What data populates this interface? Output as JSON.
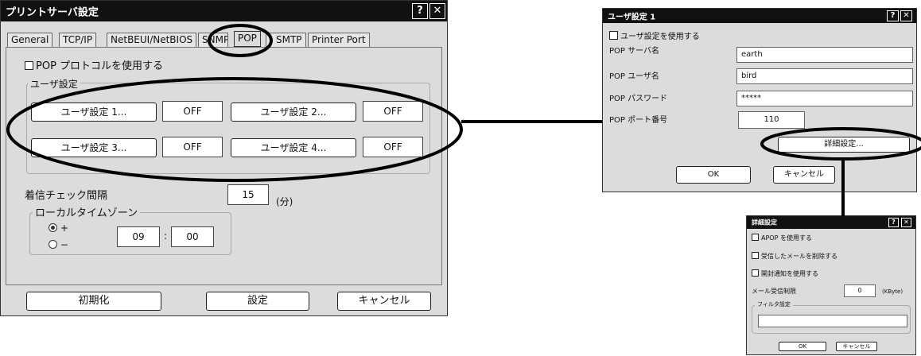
{
  "main_dialog": {
    "title": "プリントサーバ設定",
    "help": "?",
    "close": "✕",
    "tabs": [
      "General",
      "TCP/IP",
      "NetBEUI/NetBIOS",
      "SNMP",
      "POP",
      "SMTP",
      "Printer Port"
    ],
    "use_pop": "POP プロトコルを使用する",
    "user_group_title": "ユーザ設定",
    "users": [
      {
        "button": "ユーザ設定 1...",
        "status": "OFF"
      },
      {
        "button": "ユーザ設定 2...",
        "status": "OFF"
      },
      {
        "button": "ユーザ設定 3...",
        "status": "OFF"
      },
      {
        "button": "ユーザ設定 4...",
        "status": "OFF"
      }
    ],
    "check_interval_label": "着信チェック間隔",
    "check_interval_value": "15",
    "check_interval_unit": "(分)",
    "tz_group_title": "ローカルタイムゾーン",
    "tz_plus": "+",
    "tz_minus": "−",
    "tz_hours": "09",
    "tz_sep": ":",
    "tz_minutes": "00",
    "init_button": "初期化",
    "set_button": "設定",
    "cancel_button": "キャンセル"
  },
  "user_dialog": {
    "title": "ユーザ設定 1",
    "help": "?",
    "close": "✕",
    "use_user": "ユーザ設定を使用する",
    "fields": [
      {
        "label": "POP サーバ名",
        "value": "earth"
      },
      {
        "label": "POP ユーザ名",
        "value": "bird"
      },
      {
        "label": "POP パスワード",
        "value": "*****"
      }
    ],
    "port_label": "POP ポート番号",
    "port_value": "110",
    "detail_button": "詳細設定...",
    "ok_button": "OK",
    "cancel_button": "キャンセル"
  },
  "detail_dialog": {
    "title": "詳細設定",
    "help": "?",
    "close": "✕",
    "apop": "APOP を使用する",
    "delete_mail": "受信したメールを削除する",
    "notify": "開封通知を使用する",
    "limit_label": "メール受信制限",
    "limit_value": "0",
    "limit_unit": "(KByte)",
    "filter_title": "フィルタ設定",
    "ok_button": "OK",
    "cancel_button": "キャンセル"
  }
}
